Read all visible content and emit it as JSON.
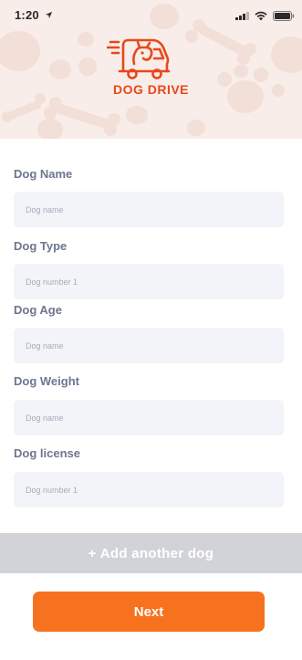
{
  "status_bar": {
    "time": "1:20",
    "location_icon": "navigation-arrow-icon",
    "signal_icon": "cellular-signal-icon",
    "wifi_icon": "wifi-icon",
    "battery_icon": "battery-icon"
  },
  "brand": {
    "logo_icon": "dog-car-logo-icon",
    "name": "DOG DRIVE",
    "accent_color": "#e8471c",
    "header_bg": "#f8ede8"
  },
  "form": {
    "fields": [
      {
        "label": "Dog Name",
        "placeholder": "Dog name",
        "value": ""
      },
      {
        "label": "Dog Type",
        "placeholder": "Dog number 1",
        "value": ""
      },
      {
        "label": "Dog Age",
        "placeholder": "Dog name",
        "value": ""
      },
      {
        "label": "Dog Weight",
        "placeholder": "Dog name",
        "value": ""
      },
      {
        "label": "Dog license",
        "placeholder": "Dog number 1",
        "value": ""
      }
    ]
  },
  "actions": {
    "add_dog_label": "+ Add another dog",
    "next_label": "Next",
    "primary_color": "#f6721f",
    "secondary_color": "#d2d3d8"
  }
}
